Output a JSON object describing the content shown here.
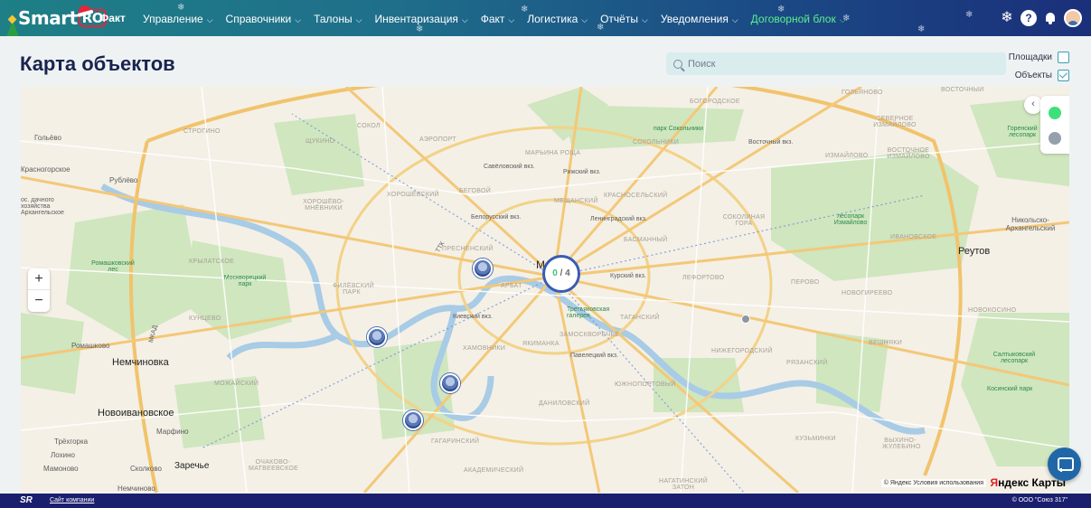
{
  "app": {
    "logo_text": "Smart",
    "logo_badge": "RO",
    "brand_suffix": "Факт"
  },
  "nav": {
    "items": [
      {
        "label": "Управление",
        "has_menu": true
      },
      {
        "label": "Справочники",
        "has_menu": true
      },
      {
        "label": "Талоны",
        "has_menu": true
      },
      {
        "label": "Инвентаризация",
        "has_menu": true
      },
      {
        "label": "Факт",
        "has_menu": true
      },
      {
        "label": "Логистика",
        "has_menu": true
      },
      {
        "label": "Отчёты",
        "has_menu": true
      },
      {
        "label": "Уведомления",
        "has_menu": true
      },
      {
        "label": "Договорной блок",
        "has_menu": true,
        "accent": true
      }
    ]
  },
  "header": {
    "title": "Карта объектов"
  },
  "search": {
    "placeholder": "Поиск",
    "value": ""
  },
  "filters": {
    "sites_label": "Площадки",
    "sites_checked": false,
    "objects_label": "Объекты",
    "objects_checked": true
  },
  "map": {
    "cluster_green": "0",
    "cluster_sep": " / ",
    "cluster_total": "4",
    "zoom_in": "+",
    "zoom_out": "−",
    "collapse": "‹",
    "legend_colors": {
      "active": "#3ee07a",
      "inactive": "#96a0ad"
    },
    "attribution": "© Яндекс Условия использования",
    "provider_y": "Я",
    "provider_rest": "ндекс Карты",
    "labels": {
      "golyanovo": "ГОЛЬЯНОВО",
      "vostochny": "ВОСТОЧНЫЙ",
      "bogorodskoe": "БОГОРОДСКОЕ",
      "sokol": "СОКОЛ",
      "aeroport": "АЭРОПОРТ",
      "maryina_roshcha": "МАРЬИНА РОЩА",
      "park_sokolniki": "парк Сокольники",
      "sokolniki": "СОКОЛЬНИКИ",
      "severnoe_izmailovo": "СЕВЕРНОЕ ИЗМАЙЛОВО",
      "gorenskiy_les": "Горенский лесопарк",
      "golyevo": "Гольёво",
      "shchukino": "ЩУКИНО",
      "strogino": "СТРОГИНО",
      "savelovskiy": "Савёловский вкз.",
      "rizhsky": "Рижский вкз.",
      "vostochny_vkz": "Восточный вкз.",
      "izmailovo": "ИЗМАЙЛОВО",
      "vostochnoe_izmailovo": "ВОСТОЧНОЕ ИЗМАЙЛОВО",
      "krasnogorskoe": "Красногорское",
      "rublevo": "Рублёво",
      "khoroshevo": "ХОРОШЁВО-МНЁВНИКИ",
      "khoroshevsky": "ХОРОШЁВСКИЙ",
      "begovoy": "БЕГОВОЙ",
      "meshchansky": "МЕЩАНСКИЙ",
      "krasnoselsky": "КРАСНОСЕЛЬСКИЙ",
      "belorussky": "Белорусский вкз.",
      "leningradsky": "Ленинградский вкз.",
      "sokolinaya_gora": "СОКОЛИНАЯ ГОРА",
      "lesopark_izm": "лесопарк Измайлово",
      "ivanovskoe": "ИВАНОВСКОЕ",
      "nikolsko": "Никольско-Архангельский",
      "dachnoe": "ос. дачного хозяйства Архангельское",
      "presnensky": "ПРЕСНЕНСКИЙ",
      "basmanny": "БАСМАННЫЙ",
      "reutov": "Реутов",
      "romashkovsky": "Ромашковский лес",
      "krylatskoe": "КРЫЛАТСКОЕ",
      "moskvoretsky": "Москворецкий парк",
      "filevsky": "ФИЛЁВСКИЙ ПАРК",
      "arbat": "АРБАТ",
      "kursky": "Курский вкз.",
      "lefortovo": "ЛЕФОРТОВО",
      "perovo": "ПЕРОВО",
      "novogireevo": "НОВОГИРЕЕВО",
      "kuntsevo": "КУНЦЕВО",
      "kievsky": "Киевский вкз.",
      "tretyakov": "Третьяковская галерея",
      "tagansky": "ТАГАНСКИЙ",
      "novokosino": "НОВОКОСИНО",
      "romashkovo": "Ромашково",
      "nemchinovka": "Немчиновка",
      "khamovniki": "ХАМОВНИКИ",
      "zamoskvorechye": "ЗАМОСКВОРЕЧЬЕ",
      "yakimanka": "ЯКИМАНКА",
      "paveletsky": "Павелецкий вкз.",
      "nizhegorodsky": "НИЖЕГОРОДСКИЙ",
      "veshnyaki": "ВЕШНЯКИ",
      "saltykovsky": "Салтыковский лесопарк",
      "ryazansky": "РЯЗАНСКИЙ",
      "mozhaysky": "МОЖАЙСКИЙ",
      "yuzhnoportovy": "ЮЖНОПОРТОВЫЙ",
      "kosinsky": "Косинский парк",
      "novoivanovskoe": "Новоивановское",
      "marfino": "Марфино",
      "danilovsky": "ДАНИЛОВСКИЙ",
      "kuzminki": "КУЗЬМИНКИ",
      "vykhino": "ВЫХИНО-ЖУЛЕБИНО",
      "tryokhgorka": "Трёхгорка",
      "lokhino": "Лохино",
      "mamonovo": "Мамоново",
      "skolkovo": "Сколково",
      "zarechye": "Заречье",
      "ochakovo": "ОЧАКОВО-МАТВЕЕВСКОЕ",
      "gagarinsky": "ГАГАРИНСКИЙ",
      "akademichesky": "АКАДЕМИЧЕСКИЙ",
      "nagatinsky": "НАГАТИНСКИЙ ЗАТОН",
      "nemchinovo": "Немчиново",
      "mkad": "МКАД",
      "ttk": "ТТК",
      "m_letter": "М"
    }
  },
  "footer": {
    "logo": "SR",
    "link": "Сайт компании",
    "copyright": "© ООО \"Союз 317\""
  }
}
